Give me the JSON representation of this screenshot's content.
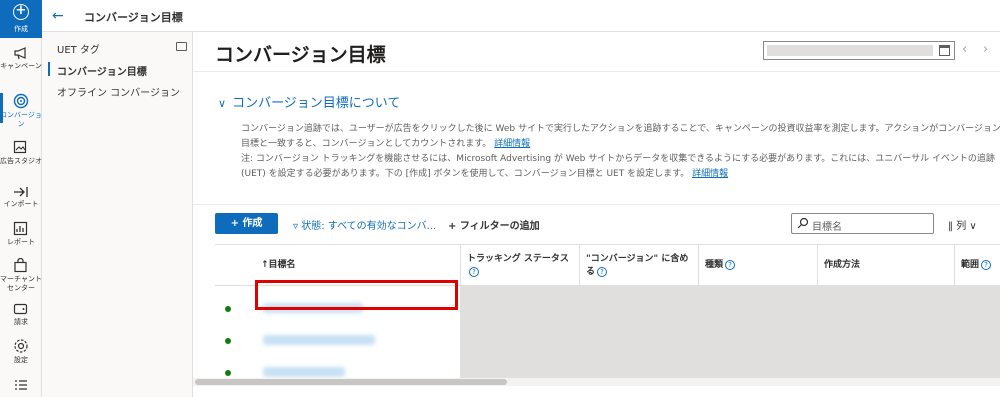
{
  "rail": {
    "create": "作成",
    "items": [
      "キャンペーン",
      "コンバージョン",
      "広告スタジオ",
      "インポート",
      "レポート",
      "マーチャント センター",
      "請求",
      "設定"
    ]
  },
  "topbar": {
    "title": "コンバージョン目標"
  },
  "subnav": {
    "items": [
      "UET タグ",
      "コンバージョン目標",
      "オフライン コンバージョン"
    ]
  },
  "main": {
    "title": "コンバージョン目標",
    "about": {
      "heading": "コンバージョン目標について",
      "para1": "コンバージョン追跡では、ユーザーが広告をクリックした後に Web サイトで実行したアクションを追跡することで、キャンペーンの投資収益率を測定します。アクションがコンバージョン目標と一致すると、コンバージョンとしてカウントされます。",
      "link1": "詳細情報",
      "para2": "注: コンバージョン トラッキングを機能させるには、Microsoft Advertising が Web サイトからデータを収集できるようにする必要があります。これには、ユニバーサル イベントの追跡 (UET) を設定する必要があります。下の [作成] ボタンを使用して、コンバージョン目標と UET を設定します。",
      "link2": "詳細情報"
    },
    "toolbar": {
      "create": "作成",
      "status_filter": "状態: すべての有効なコンバ...",
      "add_filter": "フィルターの追加",
      "search_placeholder": "目標名",
      "columns": "列"
    },
    "table": {
      "headers": [
        "目標名",
        "トラッキング ステータス",
        "\"コンバージョン\" に含める",
        "種類",
        "作成方法",
        "範囲"
      ]
    }
  },
  "colors": {
    "accent": "#0f6cbd",
    "status_active": "#107c10",
    "highlight": "#e00000"
  }
}
